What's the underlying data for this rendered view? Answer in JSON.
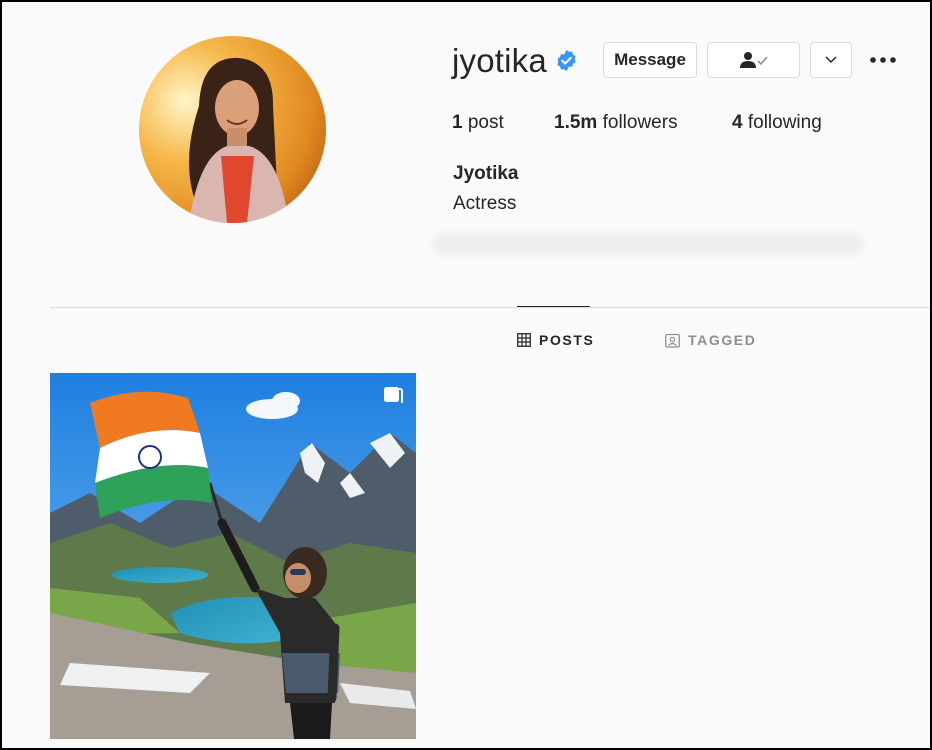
{
  "profile": {
    "username": "jyotika",
    "full_name": "Jyotika",
    "bio": "Actress",
    "verified": true
  },
  "actions": {
    "message_label": "Message",
    "follow_icon": "person-check-icon",
    "more_icon": "chevron-down-icon",
    "options_icon": "more-dots-icon"
  },
  "stats": {
    "posts_count": "1",
    "posts_label": "post",
    "followers_count": "1.5m",
    "followers_label": "followers",
    "following_count": "4",
    "following_label": "following"
  },
  "tabs": [
    {
      "label": "POSTS",
      "icon": "grid-icon",
      "active": true
    },
    {
      "label": "TAGGED",
      "icon": "tag-icon",
      "active": false
    }
  ],
  "posts": [
    {
      "type": "multi-image",
      "icon": "multiple-images-icon"
    }
  ],
  "colors": {
    "verified_blue": "#3897f0",
    "text": "#262626",
    "muted": "#8e8e8e",
    "border": "#dbdbdb"
  }
}
